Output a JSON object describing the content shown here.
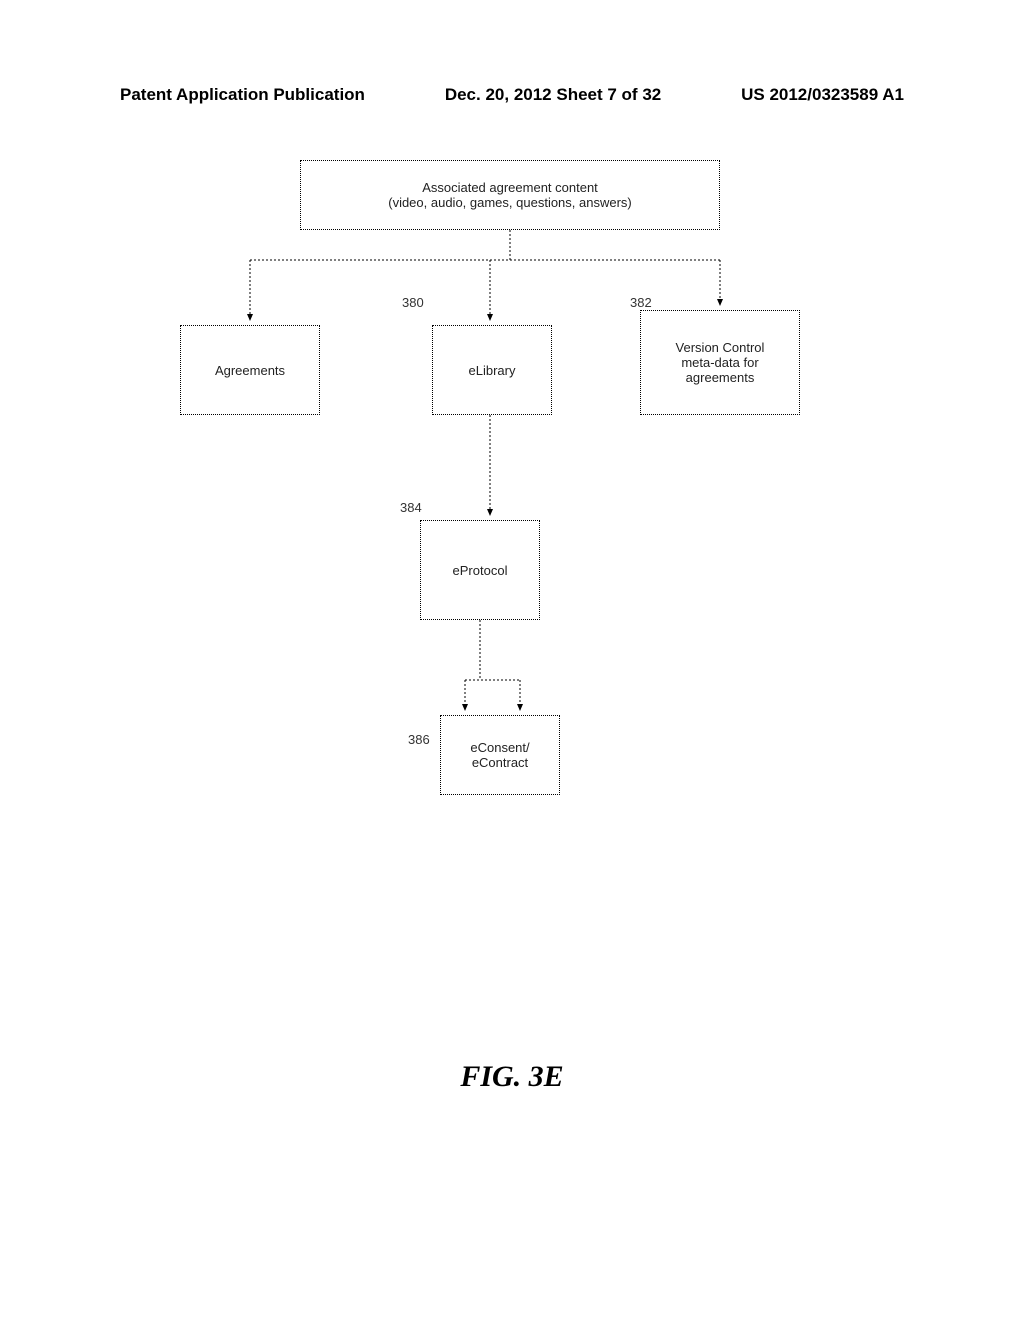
{
  "header": {
    "left": "Patent Application Publication",
    "center": "Dec. 20, 2012  Sheet 7 of 32",
    "right": "US 2012/0323589 A1"
  },
  "boxes": {
    "top": {
      "line1": "Associated agreement content",
      "line2": "(video, audio, games, questions, answers)"
    },
    "agreements": "Agreements",
    "elibrary": "eLibrary",
    "version": {
      "line1": "Version Control",
      "line2": "meta-data for",
      "line3": "agreements"
    },
    "eprotocol": "eProtocol",
    "econsent": {
      "line1": "eConsent/",
      "line2": "eContract"
    }
  },
  "labels": {
    "l380": "380",
    "l382": "382",
    "l384": "384",
    "l386": "386"
  },
  "figure_caption": "FIG. 3E"
}
